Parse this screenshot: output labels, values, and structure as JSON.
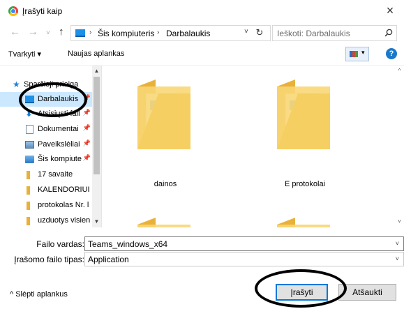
{
  "window": {
    "title": "Įrašyti kaip",
    "close_icon": "×"
  },
  "navigation": {
    "back_icon": "←",
    "forward_icon": "→",
    "recent_icon": "˅",
    "up_icon": "↑",
    "breadcrumb": [
      "Šis kompiuteris",
      "Darbalaukis"
    ],
    "breadcrumb_separator": "›",
    "address_dropdown_icon": "˅",
    "refresh_icon": "↻",
    "search_placeholder": "Ieškoti: Darbalaukis"
  },
  "toolbar": {
    "organize_label": "Tvarkyti ▾",
    "new_folder_label": "Naujas aplankas",
    "view_dropdown_icon": "▾",
    "help_label": "?"
  },
  "sidebar": {
    "items": [
      {
        "label": "Sparčioji prieiga",
        "icon": "star-icon",
        "pinned": false
      },
      {
        "label": "Darbalaukis",
        "icon": "desktop-icon",
        "pinned": true,
        "selected": true
      },
      {
        "label": "Atsisiųsti fail",
        "icon": "download-icon",
        "pinned": true
      },
      {
        "label": "Dokumentai",
        "icon": "documents-icon",
        "pinned": true
      },
      {
        "label": "Paveikslėliai",
        "icon": "pictures-icon",
        "pinned": true
      },
      {
        "label": "Šis kompiute",
        "icon": "computer-icon",
        "pinned": true
      },
      {
        "label": "17 savaite",
        "icon": "folder-icon",
        "pinned": false
      },
      {
        "label": "KALENDORIUI",
        "icon": "folder-icon",
        "pinned": false
      },
      {
        "label": "protokolas Nr. l",
        "icon": "folder-icon",
        "pinned": false
      },
      {
        "label": "uzduotys visien",
        "icon": "folder-icon",
        "pinned": false
      }
    ],
    "pin_icon": "📌"
  },
  "content": {
    "folders": [
      {
        "label": "dainos"
      },
      {
        "label": "E protokolai"
      },
      {
        "label": ""
      },
      {
        "label": ""
      }
    ]
  },
  "form": {
    "filename_label": "Failo vardas:",
    "filename_value": "Teams_windows_x64",
    "filetype_label": "Įrašomo failo tipas:",
    "filetype_value": "Application",
    "chevron_icon": "˅"
  },
  "footer": {
    "hide_folders_label": "^ Slėpti aplankus",
    "save_label": "Įrašyti",
    "cancel_label": "Atšaukti"
  },
  "colors": {
    "accent": "#0078d7",
    "selection": "#cce8ff",
    "folder": "#f8d775"
  }
}
